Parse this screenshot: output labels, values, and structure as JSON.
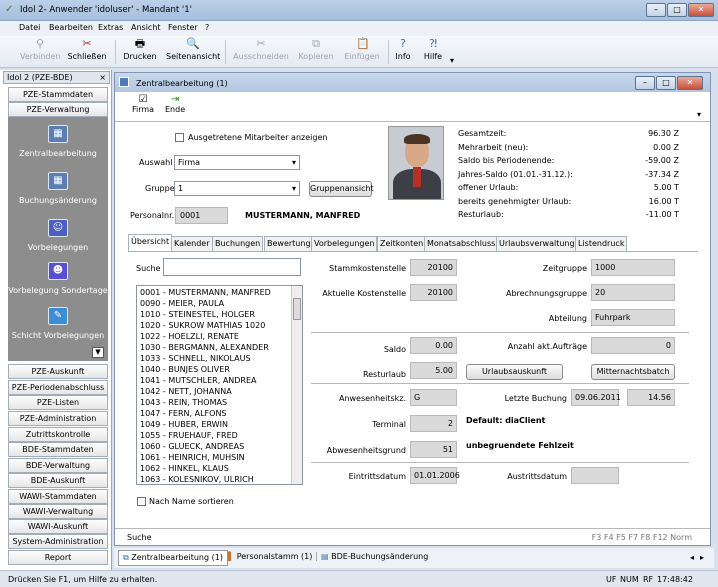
{
  "window": {
    "title": "Idol 2- Anwender 'idoluser' - Mandant '1'"
  },
  "menu": [
    "Datei",
    "Bearbeiten",
    "Extras",
    "Ansicht",
    "Fenster",
    "?"
  ],
  "toolbar": {
    "verbinden": "Verbinden",
    "schliessen": "Schließen",
    "drucken": "Drucken",
    "seitenansicht": "Seitenansicht",
    "ausschneiden": "Ausschneiden",
    "kopieren": "Kopieren",
    "einfuegen": "Einfügen",
    "info": "Info",
    "hilfe": "Hilfe"
  },
  "sidebar": {
    "header": "Idol 2 (PZE-BDE)",
    "close": "×",
    "top": [
      "PZE-Stammdaten",
      "PZE-Verwaltung"
    ],
    "group": [
      "Zentralbearbeitung",
      "Buchungsänderung",
      "Vorbelegungen",
      "Vorbelegung Sondertage",
      "Schicht Vorbelegungen"
    ],
    "bottom": [
      "PZE-Auskunft",
      "PZE-Periodenabschluss",
      "PZE-Listen",
      "PZE-Administration",
      "Zutrittskontrolle",
      "BDE-Stammdaten",
      "BDE-Verwaltung",
      "BDE-Auskunft",
      "WAWI-Stammdaten",
      "WAWI-Verwaltung",
      "WAWI-Auskunft",
      "System-Administration",
      "Report"
    ]
  },
  "child": {
    "title": "Zentralbearbeitung (1)",
    "firma": "Firma",
    "ende": "Ende"
  },
  "form": {
    "ausgetretene": "Ausgetretene Mitarbeiter anzeigen",
    "auswahl_label": "Auswahl",
    "auswahl_value": "Firma",
    "gruppe_label": "Gruppe",
    "gruppe_value": "1",
    "gruppenansicht": "Gruppenansicht",
    "personalnr_label": "Personalnr.",
    "personalnr_value": "0001",
    "name": "MUSTERMANN, MANFRED"
  },
  "summary": [
    {
      "label": "Gesamtzeit:",
      "value": "96.30 Z"
    },
    {
      "label": "Mehrarbeit (neu):",
      "value": "0.00 Z"
    },
    {
      "label": "Saldo bis Periodenende:",
      "value": "-59.00 Z"
    },
    {
      "label": "Jahres-Saldo (01.01.-31.12.):",
      "value": "-37.34 Z"
    },
    {
      "label": "offener Urlaub:",
      "value": "5.00 T"
    },
    {
      "label": "bereits genehmigter Urlaub:",
      "value": "16.00 T"
    },
    {
      "label": "Resturlaub:",
      "value": "-11.00 T"
    }
  ],
  "tabs": [
    "Übersicht",
    "Kalender",
    "Buchungen",
    "Bewertung",
    "Vorbelegungen",
    "Zeitkonten",
    "Monatsabschluss",
    "Urlaubsverwaltung",
    "Listendruck"
  ],
  "suche_label": "Suche",
  "employees": [
    "0001 - MUSTERMANN, MANFRED",
    "0090 - MEIER, PAULA",
    "1010 - STEINESTEL, HOLGER",
    "1020 - SUKROW MATHIAS 1020",
    "1022 - HOELZLI, RENATE",
    "1030 - BERGMANN, ALEXANDER",
    "1033 - SCHNELL, NIKOLAUS",
    "1040 - BUNJES OLIVER",
    "1041 - MUTSCHLER, ANDREA",
    "1042 - NETT, JOHANNA",
    "1043 - REIN, THOMAS",
    "1047 - FERN, ALFONS",
    "1049 - HUBER, ERWIN",
    "1055 - FRUEHAUF, FRED",
    "1060 - GLUECK, ANDREAS",
    "1061 - HEINRICH, MUHSIN",
    "1062 - HINKEL, KLAUS",
    "1063 - KOLESNIKOV, ULRICH"
  ],
  "nach_name": "Nach Name sortieren",
  "details": {
    "stammkst_label": "Stammkostenstelle",
    "stammkst": "20100",
    "zeitgruppe_label": "Zeitgruppe",
    "zeitgruppe": "1000",
    "aktkst_label": "Aktuelle Kostenstelle",
    "aktkst": "20100",
    "abrgruppe_label": "Abrechnungsgruppe",
    "abrgruppe": "20",
    "abteilung_label": "Abteilung",
    "abteilung": "Fuhrpark",
    "saldo_label": "Saldo",
    "saldo": "0.00",
    "auftraege_label": "Anzahl akt.Aufträge",
    "auftraege": "0",
    "resturlaub_label": "Resturlaub",
    "resturlaub": "5.00",
    "urlaubsauskunft": "Urlaubsauskunft",
    "mitternachtsbatch": "Mitternachtsbatch",
    "anwesenheit_label": "Anwesenheitskz.",
    "anwesenheit": "G",
    "letzte_label": "Letzte Buchung",
    "letzte_datum": "09.06.2011",
    "letzte_zeit": "14.56",
    "terminal_label": "Terminal",
    "terminal": "2",
    "default_client": "Default: diaClient",
    "abwesenheit_label": "Abwesenheitsgrund",
    "abwesenheit": "51",
    "fehlzeit": "unbegruendete Fehlzeit",
    "eintritt_label": "Eintrittsdatum",
    "eintritt": "01.01.2006",
    "austritt_label": "Austrittsdatum",
    "austritt": ""
  },
  "child_status": {
    "suche": "Suche",
    "keys": "F3  F4  F5  F7  F8  F12  Norm"
  },
  "bottom_tabs": [
    "Zentralbearbeitung (1)",
    "Personalstamm (1)",
    "BDE-Buchungsänderung"
  ],
  "statusbar": {
    "help": "Drücken Sie F1, um Hilfe zu erhalten.",
    "uf": "UF",
    "num": "NUM",
    "rf": "RF",
    "time": "17:48:42"
  }
}
